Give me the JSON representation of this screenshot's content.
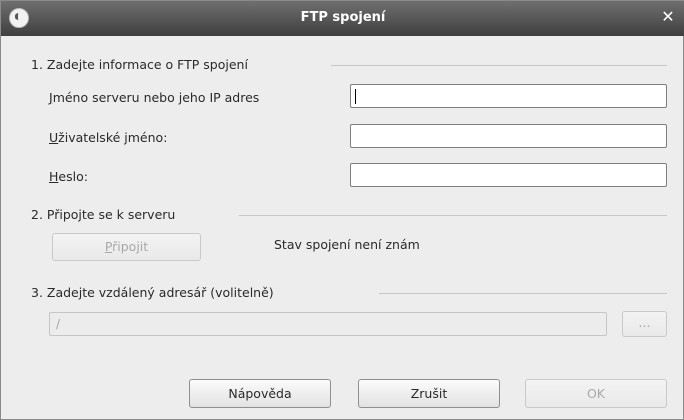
{
  "window": {
    "title": "FTP spojení",
    "close_glyph": "✕"
  },
  "section1": {
    "title": "1. Zadejte informace o FTP spojení",
    "server_label_first": "J",
    "server_label_rest": "méno serveru nebo jeho IP adres",
    "user_label_first": "U",
    "user_label_rest": "živatelské jméno:",
    "password_label_first": "H",
    "password_label_rest": "eslo:",
    "server_value": "",
    "user_value": "",
    "password_value": ""
  },
  "section2": {
    "title": "2. Připojte se k serveru",
    "connect_label_first": "P",
    "connect_label_rest": "řipojit",
    "status": "Stav spojení není znám"
  },
  "section3": {
    "title": "3. Zadejte vzdálený adresář (volitelně)",
    "directory_value": "/",
    "browse_label": "..."
  },
  "footer": {
    "help_label": "Nápověda",
    "cancel_label": "Zrušit",
    "ok_label": "OK"
  }
}
